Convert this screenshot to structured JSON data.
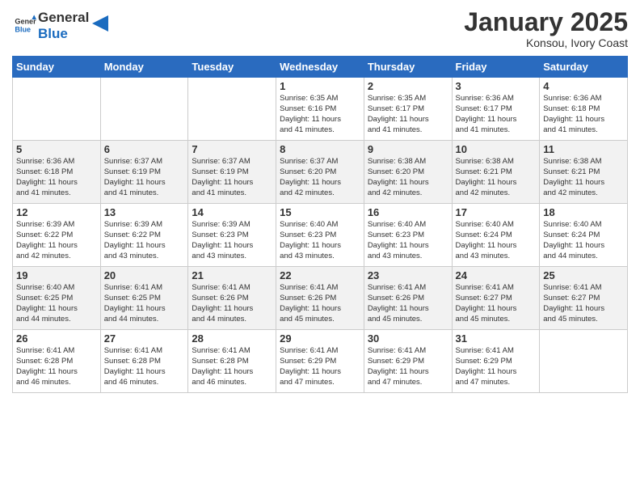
{
  "header": {
    "logo_general": "General",
    "logo_blue": "Blue",
    "month": "January 2025",
    "location": "Konsou, Ivory Coast"
  },
  "days_of_week": [
    "Sunday",
    "Monday",
    "Tuesday",
    "Wednesday",
    "Thursday",
    "Friday",
    "Saturday"
  ],
  "weeks": [
    [
      {
        "day": "",
        "info": ""
      },
      {
        "day": "",
        "info": ""
      },
      {
        "day": "",
        "info": ""
      },
      {
        "day": "1",
        "info": "Sunrise: 6:35 AM\nSunset: 6:16 PM\nDaylight: 11 hours\nand 41 minutes."
      },
      {
        "day": "2",
        "info": "Sunrise: 6:35 AM\nSunset: 6:17 PM\nDaylight: 11 hours\nand 41 minutes."
      },
      {
        "day": "3",
        "info": "Sunrise: 6:36 AM\nSunset: 6:17 PM\nDaylight: 11 hours\nand 41 minutes."
      },
      {
        "day": "4",
        "info": "Sunrise: 6:36 AM\nSunset: 6:18 PM\nDaylight: 11 hours\nand 41 minutes."
      }
    ],
    [
      {
        "day": "5",
        "info": "Sunrise: 6:36 AM\nSunset: 6:18 PM\nDaylight: 11 hours\nand 41 minutes."
      },
      {
        "day": "6",
        "info": "Sunrise: 6:37 AM\nSunset: 6:19 PM\nDaylight: 11 hours\nand 41 minutes."
      },
      {
        "day": "7",
        "info": "Sunrise: 6:37 AM\nSunset: 6:19 PM\nDaylight: 11 hours\nand 41 minutes."
      },
      {
        "day": "8",
        "info": "Sunrise: 6:37 AM\nSunset: 6:20 PM\nDaylight: 11 hours\nand 42 minutes."
      },
      {
        "day": "9",
        "info": "Sunrise: 6:38 AM\nSunset: 6:20 PM\nDaylight: 11 hours\nand 42 minutes."
      },
      {
        "day": "10",
        "info": "Sunrise: 6:38 AM\nSunset: 6:21 PM\nDaylight: 11 hours\nand 42 minutes."
      },
      {
        "day": "11",
        "info": "Sunrise: 6:38 AM\nSunset: 6:21 PM\nDaylight: 11 hours\nand 42 minutes."
      }
    ],
    [
      {
        "day": "12",
        "info": "Sunrise: 6:39 AM\nSunset: 6:22 PM\nDaylight: 11 hours\nand 42 minutes."
      },
      {
        "day": "13",
        "info": "Sunrise: 6:39 AM\nSunset: 6:22 PM\nDaylight: 11 hours\nand 43 minutes."
      },
      {
        "day": "14",
        "info": "Sunrise: 6:39 AM\nSunset: 6:23 PM\nDaylight: 11 hours\nand 43 minutes."
      },
      {
        "day": "15",
        "info": "Sunrise: 6:40 AM\nSunset: 6:23 PM\nDaylight: 11 hours\nand 43 minutes."
      },
      {
        "day": "16",
        "info": "Sunrise: 6:40 AM\nSunset: 6:23 PM\nDaylight: 11 hours\nand 43 minutes."
      },
      {
        "day": "17",
        "info": "Sunrise: 6:40 AM\nSunset: 6:24 PM\nDaylight: 11 hours\nand 43 minutes."
      },
      {
        "day": "18",
        "info": "Sunrise: 6:40 AM\nSunset: 6:24 PM\nDaylight: 11 hours\nand 44 minutes."
      }
    ],
    [
      {
        "day": "19",
        "info": "Sunrise: 6:40 AM\nSunset: 6:25 PM\nDaylight: 11 hours\nand 44 minutes."
      },
      {
        "day": "20",
        "info": "Sunrise: 6:41 AM\nSunset: 6:25 PM\nDaylight: 11 hours\nand 44 minutes."
      },
      {
        "day": "21",
        "info": "Sunrise: 6:41 AM\nSunset: 6:26 PM\nDaylight: 11 hours\nand 44 minutes."
      },
      {
        "day": "22",
        "info": "Sunrise: 6:41 AM\nSunset: 6:26 PM\nDaylight: 11 hours\nand 45 minutes."
      },
      {
        "day": "23",
        "info": "Sunrise: 6:41 AM\nSunset: 6:26 PM\nDaylight: 11 hours\nand 45 minutes."
      },
      {
        "day": "24",
        "info": "Sunrise: 6:41 AM\nSunset: 6:27 PM\nDaylight: 11 hours\nand 45 minutes."
      },
      {
        "day": "25",
        "info": "Sunrise: 6:41 AM\nSunset: 6:27 PM\nDaylight: 11 hours\nand 45 minutes."
      }
    ],
    [
      {
        "day": "26",
        "info": "Sunrise: 6:41 AM\nSunset: 6:28 PM\nDaylight: 11 hours\nand 46 minutes."
      },
      {
        "day": "27",
        "info": "Sunrise: 6:41 AM\nSunset: 6:28 PM\nDaylight: 11 hours\nand 46 minutes."
      },
      {
        "day": "28",
        "info": "Sunrise: 6:41 AM\nSunset: 6:28 PM\nDaylight: 11 hours\nand 46 minutes."
      },
      {
        "day": "29",
        "info": "Sunrise: 6:41 AM\nSunset: 6:29 PM\nDaylight: 11 hours\nand 47 minutes."
      },
      {
        "day": "30",
        "info": "Sunrise: 6:41 AM\nSunset: 6:29 PM\nDaylight: 11 hours\nand 47 minutes."
      },
      {
        "day": "31",
        "info": "Sunrise: 6:41 AM\nSunset: 6:29 PM\nDaylight: 11 hours\nand 47 minutes."
      },
      {
        "day": "",
        "info": ""
      }
    ]
  ]
}
